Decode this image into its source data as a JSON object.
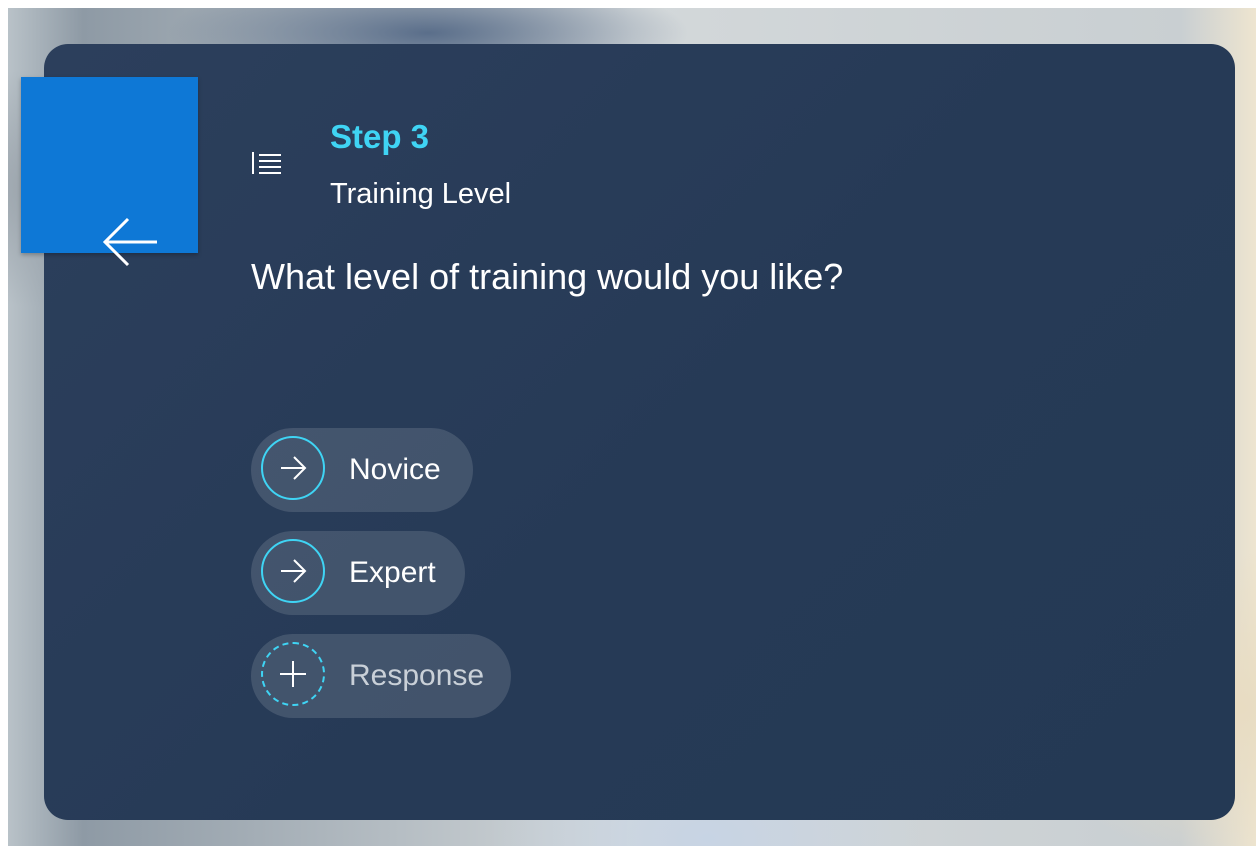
{
  "header": {
    "step_title": "Step 3",
    "step_subtitle": "Training Level",
    "step_icon": "numbered-list-icon"
  },
  "back_button": {
    "icon": "arrow-left-icon"
  },
  "question": "What level of training would you like?",
  "options": [
    {
      "label": "Novice",
      "icon": "arrow-right-icon"
    },
    {
      "label": "Expert",
      "icon": "arrow-right-icon"
    }
  ],
  "add_response": {
    "label": "Response",
    "icon": "plus-icon"
  },
  "colors": {
    "card_background": "#283c58",
    "accent": "#3fd4f4",
    "back_tile": "#0e78d6",
    "text": "#ffffff"
  }
}
